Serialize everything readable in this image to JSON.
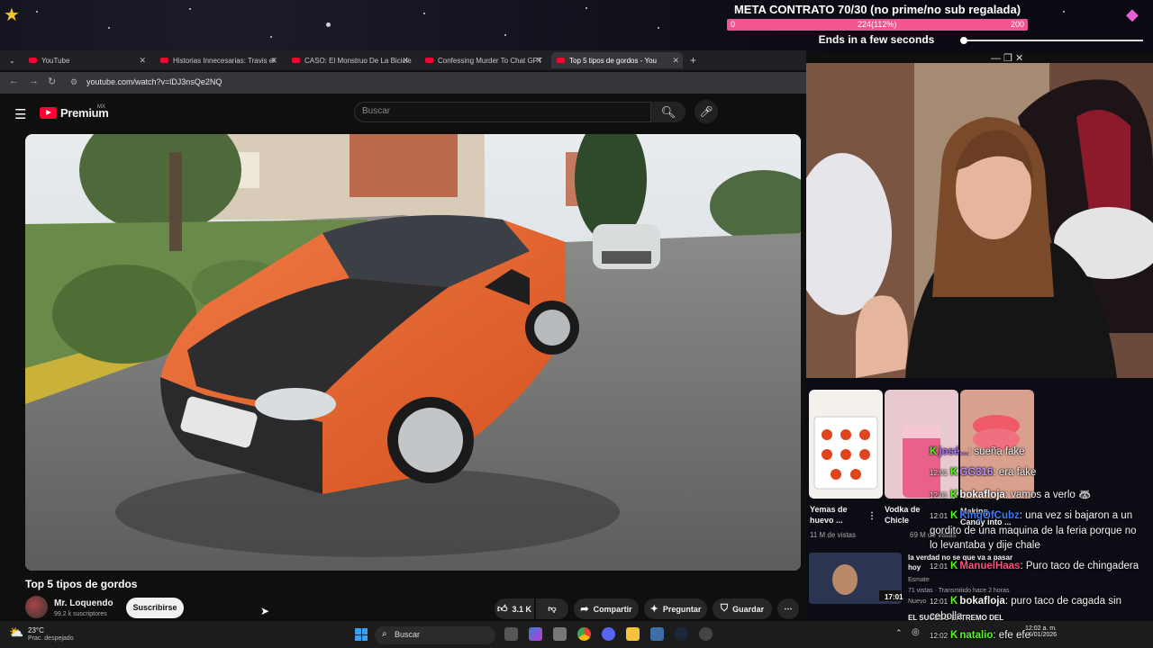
{
  "overlay": {
    "goal_title": "META CONTRATO 70/30 (no prime/no sub regalada)",
    "goal_min": "0",
    "goal_progress": "224(112%)",
    "goal_max": "200",
    "goal_fraction": 1.0,
    "timer_text": "Ends in a few seconds",
    "bar_color": "#f05590"
  },
  "browser": {
    "tabs": [
      {
        "label": "YouTube"
      },
      {
        "label": "Historias Innecesarias: Travis el"
      },
      {
        "label": "CASO: El Monstruo De La Bicicle"
      },
      {
        "label": "Confessing Murder To Chat GPT"
      },
      {
        "label": "Top 5 tipos de gordos - You",
        "active": true
      }
    ],
    "url": "youtube.com/watch?v=lDJ3nsQe2NQ",
    "window_controls": "—   ❐   ✕"
  },
  "youtube": {
    "logo_text": "Premium",
    "logo_region": "MX",
    "search_placeholder": "Buscar",
    "video_title": "Top 5 tipos de gordos",
    "channel_name": "Mr. Loquendo",
    "channel_subs": "99.2 k suscriptores",
    "subscribe_label": "Suscribirse",
    "like_count": "3.1 K",
    "share_label": "Compartir",
    "ask_label": "Preguntar",
    "save_label": "Guardar",
    "accent_color": "#ff0033"
  },
  "recommendations": [
    {
      "title": "Yemas de huevo ...",
      "views": "11 M de vistas"
    },
    {
      "title": "Vodka de Chicle",
      "views": "69 M de vistas"
    },
    {
      "title": "Making Candy into ...",
      "views": ""
    },
    {
      "title": "la verdad no se que va a pasar hoy",
      "channel": "Esmate",
      "views": "71 vistas · Transmitido hace 2 horas",
      "badge": "Nuevo",
      "duration": "17:01",
      "extra": "EL SUCESO EXTREMO DEL"
    }
  ],
  "chat": [
    {
      "time": "",
      "user": "josé...",
      "message": "sueña fake",
      "color": "#a970ff"
    },
    {
      "time": "12:01",
      "user": "GG316",
      "message": "era fake",
      "color": "#b98cff"
    },
    {
      "time": "12:01",
      "user": "bokafloja",
      "message": "vamos a verlo 🦝",
      "color": "#ffffff"
    },
    {
      "time": "12:01",
      "user": "KingOfCubz",
      "message": "una vez si bajaron a un gordito de una maquina de la feria porque no lo levantaba y dije chale",
      "color": "#3c7bff"
    },
    {
      "time": "12:01",
      "user": "ManuelHaas",
      "message": "Puro taco de chingadera",
      "color": "#ff4f7a"
    },
    {
      "time": "12:01",
      "user": "bokafloja",
      "message": "puro taco de cagada sin cebolla",
      "color": "#ffffff"
    },
    {
      "time": "12:02",
      "user": "natalio",
      "message": "efe efe",
      "color": "#53fc18"
    }
  ],
  "taskbar": {
    "temperature": "23°C",
    "weather": "Prac. despejado",
    "search_label": "Buscar",
    "time": "12:02 a. m.",
    "date": "6/01/2026"
  }
}
